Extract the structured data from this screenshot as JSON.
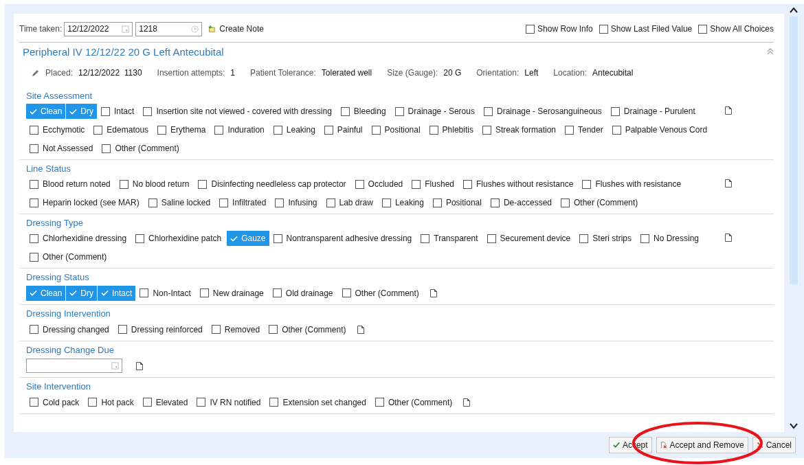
{
  "toolbar": {
    "time_label": "Time taken:",
    "date_value": "12/12/2022",
    "time_value": "1218",
    "create_note": "Create Note",
    "toggles": [
      {
        "label": "Show Row Info",
        "checked": false
      },
      {
        "label": "Show Last Filed Value",
        "checked": false
      },
      {
        "label": "Show All Choices",
        "checked": false
      }
    ]
  },
  "device": {
    "title": "Peripheral IV 12/12/22 20 G Left Antecubital",
    "expanded": true,
    "details": [
      {
        "label": "Placed:",
        "value": "12/12/2022  1130"
      },
      {
        "label": "Insertion attempts:",
        "value": "1"
      },
      {
        "label": "Patient Tolerance:",
        "value": "Tolerated well"
      },
      {
        "label": "Size (Gauge):",
        "value": "20 G"
      },
      {
        "label": "Orientation:",
        "value": "Left"
      },
      {
        "label": "Location:",
        "value": "Antecubital"
      }
    ]
  },
  "sections": [
    {
      "title": "Site Assessment",
      "kind": "checks",
      "options": [
        {
          "label": "Clean",
          "checked": true
        },
        {
          "label": "Dry",
          "checked": true
        },
        {
          "label": "Intact",
          "checked": false
        },
        {
          "label": "Insertion site not viewed - covered with dressing",
          "checked": false
        },
        {
          "label": "Bleeding",
          "checked": false
        },
        {
          "label": "Drainage - Serous",
          "checked": false
        },
        {
          "label": "Drainage - Serosanguineous",
          "checked": false
        },
        {
          "label": "Drainage - Purulent",
          "checked": false
        },
        {
          "label": "Ecchymotic",
          "checked": false
        },
        {
          "label": "Edematous",
          "checked": false
        },
        {
          "label": "Erythema",
          "checked": false
        },
        {
          "label": "Induration",
          "checked": false
        },
        {
          "label": "Leaking",
          "checked": false
        },
        {
          "label": "Painful",
          "checked": false
        },
        {
          "label": "Positional",
          "checked": false
        },
        {
          "label": "Phlebitis",
          "checked": false
        },
        {
          "label": "Streak formation",
          "checked": false
        },
        {
          "label": "Tender",
          "checked": false
        },
        {
          "label": "Palpable Venous Cord",
          "checked": false
        },
        {
          "label": "Not Assessed",
          "checked": false
        },
        {
          "label": "Other (Comment)",
          "checked": false
        }
      ]
    },
    {
      "title": "Line Status",
      "kind": "checks",
      "options": [
        {
          "label": "Blood return noted",
          "checked": false
        },
        {
          "label": "No blood return",
          "checked": false
        },
        {
          "label": "Disinfecting needleless cap protector",
          "checked": false
        },
        {
          "label": "Occluded",
          "checked": false
        },
        {
          "label": "Flushed",
          "checked": false
        },
        {
          "label": "Flushes without resistance",
          "checked": false
        },
        {
          "label": "Flushes with resistance",
          "checked": false
        },
        {
          "label": "Heparin locked (see MAR)",
          "checked": false
        },
        {
          "label": "Saline locked",
          "checked": false
        },
        {
          "label": "Infiltrated",
          "checked": false
        },
        {
          "label": "Infusing",
          "checked": false
        },
        {
          "label": "Lab draw",
          "checked": false
        },
        {
          "label": "Leaking",
          "checked": false
        },
        {
          "label": "Positional",
          "checked": false
        },
        {
          "label": "De-accessed",
          "checked": false
        },
        {
          "label": "Other (Comment)",
          "checked": false
        }
      ]
    },
    {
      "title": "Dressing Type",
      "kind": "checks",
      "options": [
        {
          "label": "Chlorhexidine dressing",
          "checked": false
        },
        {
          "label": "Chlorhexidine patch",
          "checked": false
        },
        {
          "label": "Gauze",
          "checked": true
        },
        {
          "label": "Nontransparent adhesive dressing",
          "checked": false
        },
        {
          "label": "Transparent",
          "checked": false
        },
        {
          "label": "Securement device",
          "checked": false
        },
        {
          "label": "Steri strips",
          "checked": false
        },
        {
          "label": "No Dressing",
          "checked": false
        },
        {
          "label": "Other (Comment)",
          "checked": false
        }
      ]
    },
    {
      "title": "Dressing Status",
      "kind": "checks",
      "options": [
        {
          "label": "Clean",
          "checked": true
        },
        {
          "label": "Dry",
          "checked": true
        },
        {
          "label": "Intact",
          "checked": true
        },
        {
          "label": "Non-Intact",
          "checked": false
        },
        {
          "label": "New drainage",
          "checked": false
        },
        {
          "label": "Old drainage",
          "checked": false
        },
        {
          "label": "Other (Comment)",
          "checked": false
        }
      ]
    },
    {
      "title": "Dressing Intervention",
      "kind": "checks",
      "options": [
        {
          "label": "Dressing changed",
          "checked": false
        },
        {
          "label": "Dressing reinforced",
          "checked": false
        },
        {
          "label": "Removed",
          "checked": false
        },
        {
          "label": "Other (Comment)",
          "checked": false
        }
      ]
    },
    {
      "title": "Dressing Change Due",
      "kind": "date"
    },
    {
      "title": "Site Intervention",
      "kind": "checks",
      "options": [
        {
          "label": "Cold pack",
          "checked": false
        },
        {
          "label": "Hot pack",
          "checked": false
        },
        {
          "label": "Elevated",
          "checked": false
        },
        {
          "label": "IV RN notified",
          "checked": false
        },
        {
          "label": "Extension set changed",
          "checked": false
        },
        {
          "label": "Other (Comment)",
          "checked": false
        }
      ]
    }
  ],
  "buttons": [
    {
      "label": "Accept",
      "kind": "accept"
    },
    {
      "label": "Accept and Remove",
      "kind": "accept-remove"
    },
    {
      "label": "Cancel",
      "kind": "cancel"
    }
  ],
  "annotation": {
    "kind": "ellipse",
    "color": "#e8141b"
  }
}
